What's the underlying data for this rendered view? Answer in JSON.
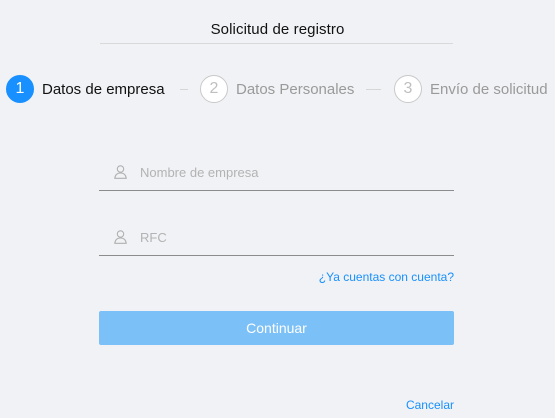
{
  "header": {
    "title": "Solicitud de registro"
  },
  "steps": [
    {
      "number": "1",
      "label": "Datos de empresa",
      "state": "active"
    },
    {
      "number": "2",
      "label": "Datos Personales",
      "state": "inactive"
    },
    {
      "number": "3",
      "label": "Envío de solicitud",
      "state": "inactive"
    }
  ],
  "form": {
    "company_name": {
      "value": "",
      "placeholder": "Nombre de empresa",
      "icon": "user-icon"
    },
    "rfc": {
      "value": "",
      "placeholder": "RFC",
      "icon": "user-icon"
    },
    "has_account_link": "¿Ya cuentas con cuenta?",
    "continue_label": "Continuar",
    "cancel_label": "Cancelar"
  },
  "colors": {
    "accent": "#1890ff",
    "button_disabled": "#7cc0f8",
    "background": "#f0f2f5"
  }
}
